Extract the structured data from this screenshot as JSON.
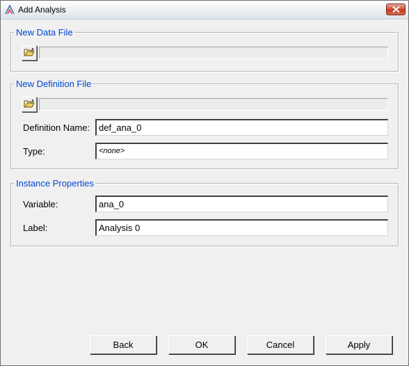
{
  "window": {
    "title": "Add Analysis"
  },
  "data_file": {
    "group_title": "New Data File",
    "browse_icon": "open-folder-icon",
    "path_value": ""
  },
  "definition_file": {
    "group_title": "New Definition File",
    "browse_icon": "open-folder-icon",
    "path_value": "",
    "name_label": "Definition Name:",
    "name_value": "def_ana_0",
    "type_label": "Type:",
    "type_value": "<none>"
  },
  "instance": {
    "group_title": "Instance Properties",
    "variable_label": "Variable:",
    "variable_value": "ana_0",
    "label_label": "Label:",
    "label_value": "Analysis 0"
  },
  "buttons": {
    "back": "Back",
    "ok": "OK",
    "cancel": "Cancel",
    "apply": "Apply"
  },
  "colors": {
    "group_title": "#0046d5",
    "close_button": "#c2381f",
    "folder": "#e8c840"
  }
}
